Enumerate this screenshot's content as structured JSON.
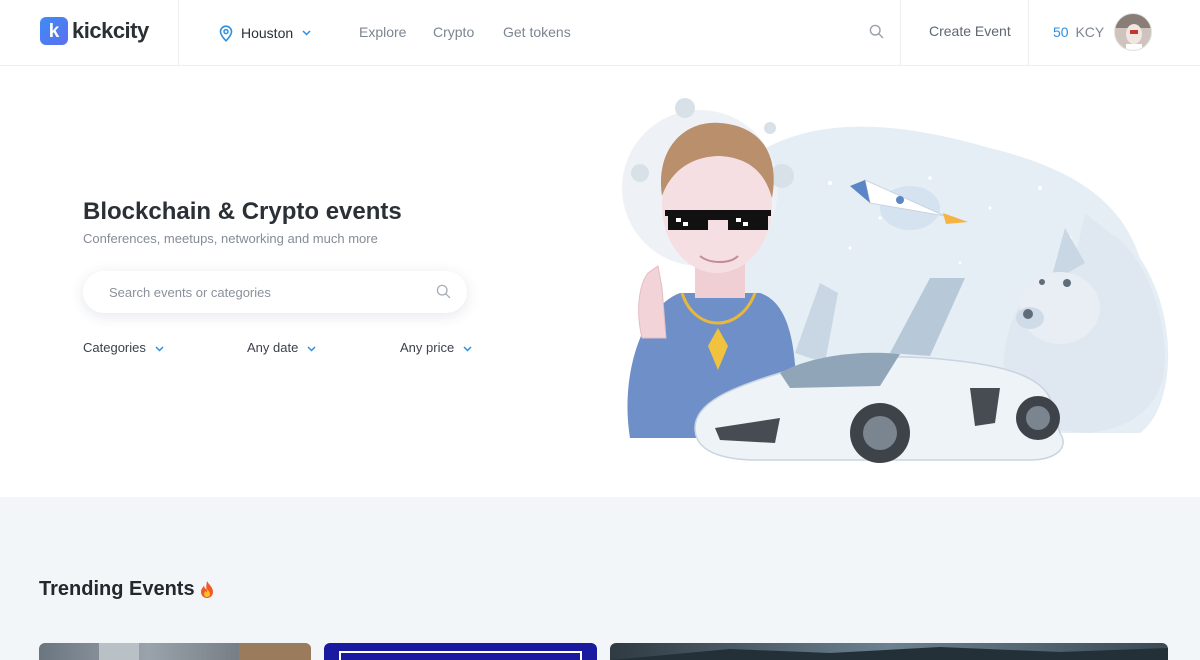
{
  "header": {
    "logo_text": "kickcity",
    "logo_letter": "k",
    "city": "Houston",
    "nav": [
      "Explore",
      "Crypto",
      "Get tokens"
    ],
    "create_event": "Create Event",
    "balance_amount": "50",
    "balance_unit": "KCY"
  },
  "hero": {
    "title": "Blockchain & Crypto events",
    "subtitle": "Conferences, meetups, networking and much more",
    "search_placeholder": "Search events or categories",
    "filters": [
      "Categories",
      "Any date",
      "Any price"
    ]
  },
  "trending": {
    "title": "Trending Events"
  },
  "colors": {
    "accent": "#2d8fe0",
    "logo_gradient_start": "#3f8cf3",
    "logo_gradient_end": "#5b6ff0",
    "section_bg": "#f3f6f9"
  },
  "icons": [
    "location-pin-icon",
    "chevron-down-icon",
    "search-icon",
    "fire-icon"
  ]
}
